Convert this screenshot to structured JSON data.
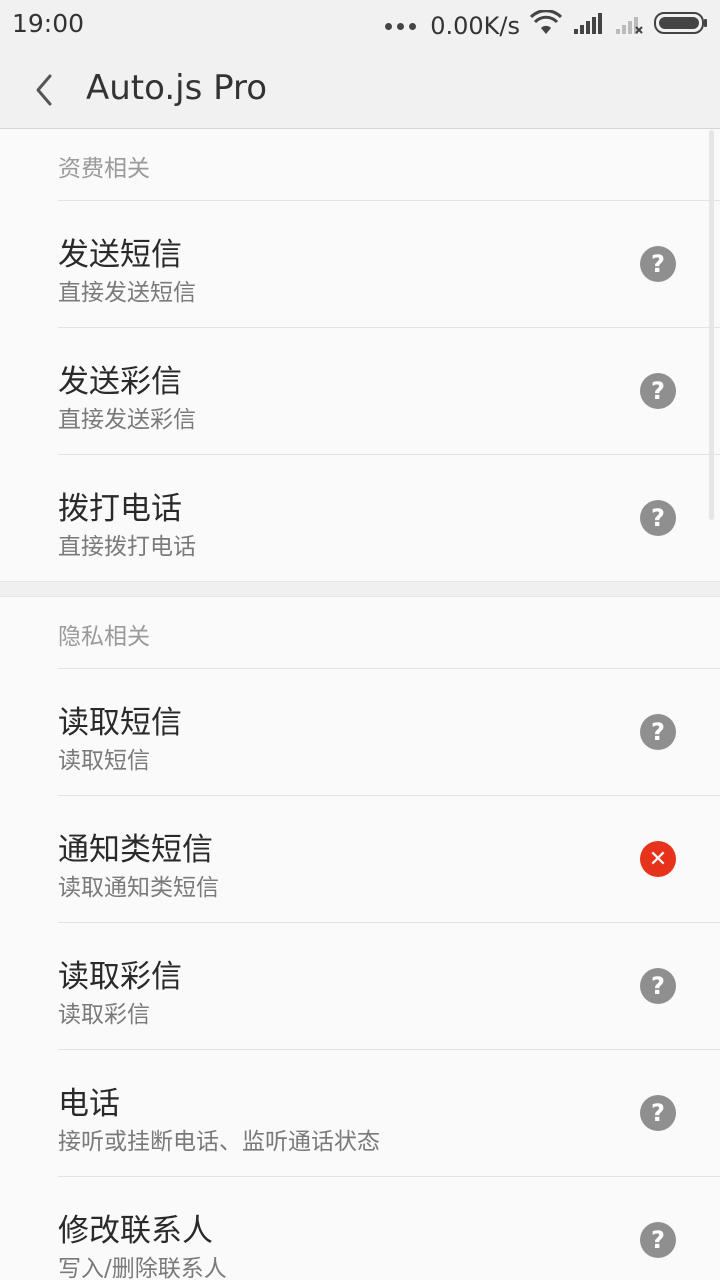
{
  "status_bar": {
    "time": "19:00",
    "net_speed": "0.00K/s"
  },
  "toolbar": {
    "title": "Auto.js  Pro"
  },
  "sections": [
    {
      "header": "资费相关",
      "items": [
        {
          "title": "发送短信",
          "subtitle": "直接发送短信",
          "status": "help"
        },
        {
          "title": "发送彩信",
          "subtitle": "直接发送彩信",
          "status": "help"
        },
        {
          "title": "拨打电话",
          "subtitle": "直接拨打电话",
          "status": "help"
        }
      ]
    },
    {
      "header": "隐私相关",
      "items": [
        {
          "title": "读取短信",
          "subtitle": "读取短信",
          "status": "help"
        },
        {
          "title": "通知类短信",
          "subtitle": "读取通知类短信",
          "status": "deny"
        },
        {
          "title": "读取彩信",
          "subtitle": "读取彩信",
          "status": "help"
        },
        {
          "title": "电话",
          "subtitle": "接听或挂断电话、监听通话状态",
          "status": "help"
        },
        {
          "title": "修改联系人",
          "subtitle": "写入/删除联系人",
          "status": "help"
        }
      ]
    }
  ],
  "icons": {
    "help": "?",
    "deny": "✕"
  },
  "colors": {
    "help": "#8f8f8f",
    "deny": "#e8331c"
  }
}
